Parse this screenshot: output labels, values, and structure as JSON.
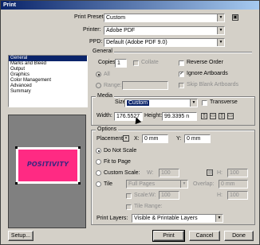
{
  "window": {
    "title": "Print"
  },
  "top": {
    "preset_label": "Print Preset:",
    "preset_value": "Custom",
    "printer_label": "Printer:",
    "printer_value": "Adobe PDF",
    "ppd_label": "PPD:",
    "ppd_value": "Default (Adobe PDF 9.0)"
  },
  "sidebar": {
    "items": [
      {
        "label": "General",
        "selected": true
      },
      {
        "label": "Marks and Bleed"
      },
      {
        "label": "Output"
      },
      {
        "label": "Graphics"
      },
      {
        "label": "Color Management"
      },
      {
        "label": "Advanced"
      },
      {
        "label": "Summary"
      }
    ]
  },
  "preview": {
    "artwork_text": "POSITIVITY"
  },
  "general": {
    "title": "General",
    "copies_label": "Copies:",
    "copies_value": "1",
    "collate_label": "Collate",
    "reverse_label": "Reverse Order",
    "all_label": "All",
    "range_label": "Range:",
    "ignore_label": "Ignore Artboards",
    "ignore_checked": true,
    "skip_label": "Skip Blank Artboards"
  },
  "media": {
    "title": "Media",
    "size_label": "Size:",
    "size_value": "Custom",
    "transverse_label": "Transverse",
    "width_label": "Width:",
    "width_value": "176.5527",
    "height_label": "Height:",
    "height_value": "99.3395 n"
  },
  "options": {
    "title": "Options",
    "placement_label": "Placement:",
    "x_label": "X:",
    "x_value": "0 mm",
    "y_label": "Y:",
    "y_value": "0 mm",
    "dont_scale_label": "Do Not Scale",
    "fit_label": "Fit to Page",
    "custom_scale_label": "Custom Scale:",
    "w_label": "W:",
    "w_value": "100",
    "h_label": "H:",
    "h_value": "100",
    "tile_label": "Tile",
    "tile_value": "Full Pages",
    "overlap_label": "Overlap:",
    "overlap_value": "0 mm",
    "scale_label": "Scale:",
    "scale_w_label": "W:",
    "scale_w_value": "100",
    "scale_h_label": "H:",
    "scale_h_value": "100",
    "tile_range_label": "Tile Range:",
    "print_layers_label": "Print Layers:",
    "print_layers_value": "Visible & Printable Layers"
  },
  "buttons": {
    "setup": "Setup...",
    "print": "Print",
    "cancel": "Cancel",
    "done": "Done"
  }
}
